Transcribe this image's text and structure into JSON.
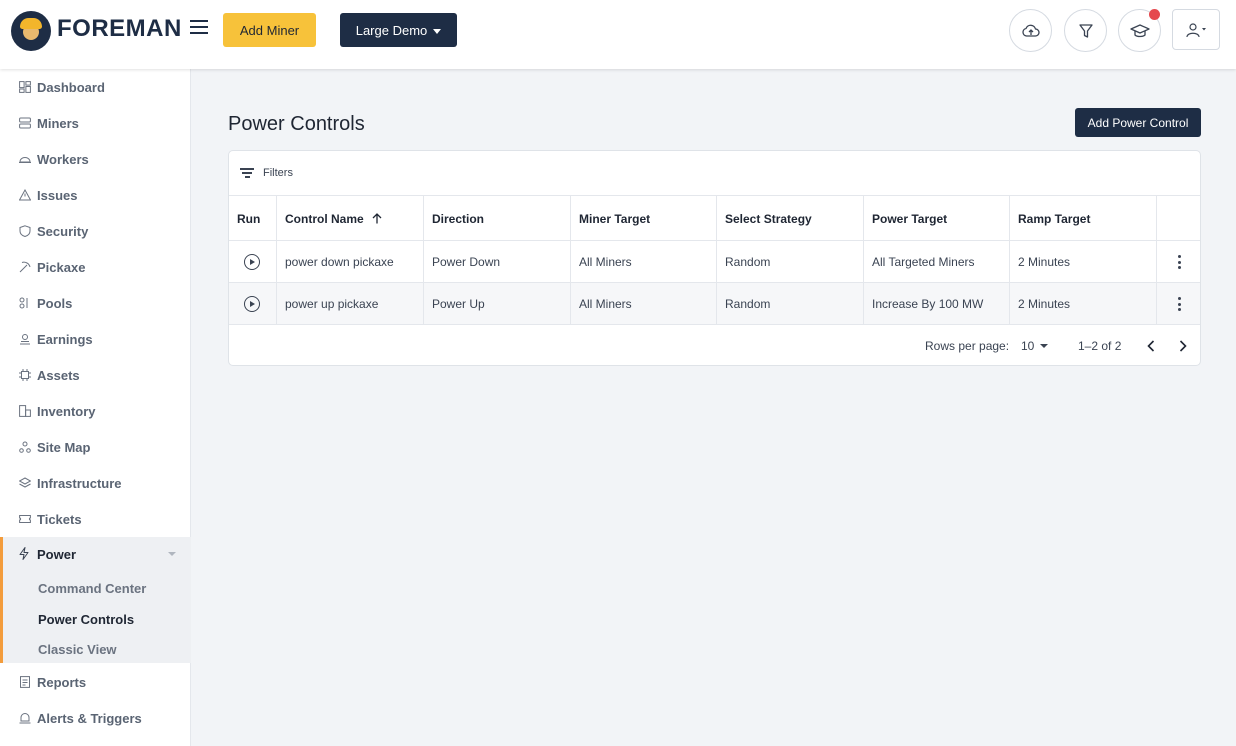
{
  "header": {
    "brand": "FOREMAN",
    "add_miner_label": "Add Miner",
    "demo_label": "Large Demo"
  },
  "sidebar": {
    "items_top": [
      {
        "label": "Dashboard",
        "icon": "dashboard-icon"
      },
      {
        "label": "Miners",
        "icon": "server-icon"
      },
      {
        "label": "Workers",
        "icon": "worker-icon"
      },
      {
        "label": "Issues",
        "icon": "warning-icon"
      },
      {
        "label": "Security",
        "icon": "shield-icon"
      },
      {
        "label": "Pickaxe",
        "icon": "pickaxe-icon"
      },
      {
        "label": "Pools",
        "icon": "pools-icon"
      },
      {
        "label": "Earnings",
        "icon": "earnings-icon"
      },
      {
        "label": "Assets",
        "icon": "chip-icon"
      },
      {
        "label": "Inventory",
        "icon": "inventory-icon"
      },
      {
        "label": "Site Map",
        "icon": "site-map-icon"
      },
      {
        "label": "Infrastructure",
        "icon": "layers-icon"
      },
      {
        "label": "Tickets",
        "icon": "ticket-icon"
      }
    ],
    "power": {
      "label": "Power",
      "children": [
        "Command Center",
        "Power Controls",
        "Classic View"
      ]
    },
    "items_bottom": [
      {
        "label": "Reports",
        "icon": "report-icon"
      },
      {
        "label": "Alerts & Triggers",
        "icon": "alert-icon"
      }
    ]
  },
  "main": {
    "title": "Power Controls",
    "add_button_label": "Add Power Control",
    "filters_label": "Filters",
    "columns": [
      "Run",
      "Control Name",
      "Direction",
      "Miner Target",
      "Select Strategy",
      "Power Target",
      "Ramp Target"
    ],
    "rows": [
      {
        "name": "power down pickaxe",
        "direction": "Power Down",
        "miner_target": "All Miners",
        "strategy": "Random",
        "power_target": "All Targeted Miners",
        "ramp_target": "2 Minutes"
      },
      {
        "name": "power up pickaxe",
        "direction": "Power Up",
        "miner_target": "All Miners",
        "strategy": "Random",
        "power_target": "Increase By 100 MW",
        "ramp_target": "2 Minutes"
      }
    ],
    "pagination": {
      "rows_per_page_label": "Rows per page:",
      "rows_per_page_value": "10",
      "range": "1–2 of 2"
    }
  },
  "colors": {
    "navy": "#1e2d45",
    "yellow": "#f7c23a",
    "accent_orange": "#f39c3c"
  }
}
